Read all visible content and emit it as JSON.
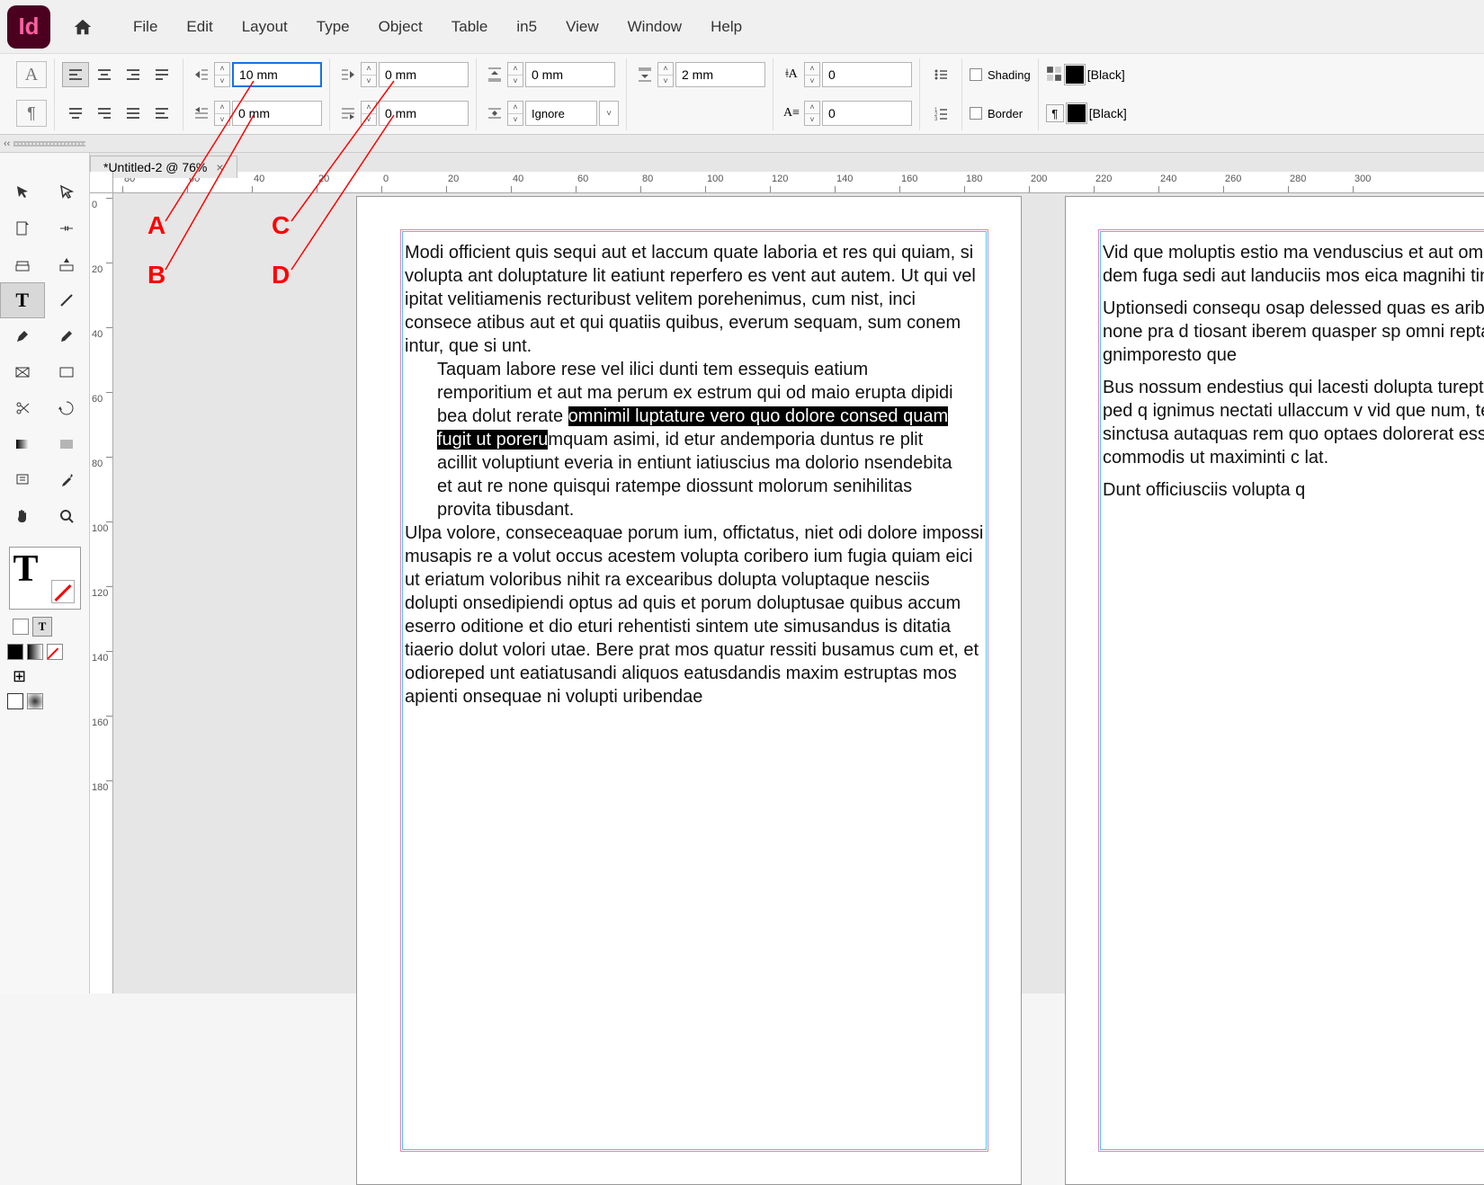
{
  "app": {
    "logo_text": "Id"
  },
  "menu": [
    "File",
    "Edit",
    "Layout",
    "Type",
    "Object",
    "Table",
    "in5",
    "View",
    "Window",
    "Help"
  ],
  "tabs": {
    "doc_title": "*Untitled-2 @ 76%"
  },
  "controls": {
    "left_indent": "10 mm",
    "first_line": "0 mm",
    "right_indent": "0 mm",
    "last_line": "0 mm",
    "space_before": "0 mm",
    "space_after": "2 mm",
    "space_between": "Ignore",
    "dropcap_lines": "0",
    "dropcap_chars": "0",
    "shading_label": "Shading",
    "border_label": "Border",
    "swatch1": "[Black]",
    "swatch2": "[Black]"
  },
  "ruler_h": [
    "80",
    "60",
    "40",
    "20",
    "0",
    "20",
    "40",
    "60",
    "80",
    "100",
    "120",
    "140",
    "160",
    "180",
    "200",
    "220",
    "240",
    "260",
    "280",
    "300"
  ],
  "ruler_v": [
    "0",
    "20",
    "40",
    "60",
    "80",
    "100",
    "120",
    "140",
    "160",
    "180"
  ],
  "annotations": {
    "a": "A",
    "b": "B",
    "c": "C",
    "d": "D"
  },
  "body": {
    "p1": "Modi officient quis sequi aut et laccum quate laboria et res qui quiam, si volupta ant doluptature lit eatiunt reperfero es vent aut autem. Ut qui vel ipitat velitiamenis recturibust velitem porehenimus, cum nist, inci consece atibus aut et qui quatiis quibus, everum sequam, sum conem intur, que si unt.",
    "p2_pre": "Taquam labore rese vel ilici dunti tem essequis eatium remporitium et aut ma perum ex estrum qui od maio erupta dipidi bea dolut rerate ",
    "p2_hl": "omnimil luptature vero quo dolore consed quam fugit ut poreru",
    "p2_post": "mquam asimi, id etur andemporia duntus re plit acillit voluptiunt everia in entiunt iatiuscius ma dolorio nsendebita et aut re none quisqui ratempe diossunt molorum senihilitas provita tibusdant.",
    "p3": "Ulpa volore, conseceaquae porum ium, offictatus, niet odi dolore impossi musapis re a volut occus acestem volupta coribero ium fugia quiam eici ut eriatum voloribus nihit ra excearibus dolupta voluptaque nesciis dolupti onsedipiendi optus ad quis et porum doluptusae quibus accum eserro oditione et dio eturi rehentisti sintem ute simusandus is ditatia tiaerio dolut volori utae. Bere prat mos quatur ressiti busamus cum et, et odioreped unt eatiatusandi aliquos eatusdandis maxim estruptas mos apienti onsequae ni volupti uribendae",
    "r1": "Vid que moluptis estio ma venduscius et aut ommos cum aut magnis dem fuga sedi aut landuciis mos eica magnihi tintor alit re vel n",
    "r2": "Uptionsedi consequ osap delessed quas es ariberese pratia dia nus, none pra d tiosant iberem quasper sp omni repta destrum fuga. dignima gnimporesto que",
    "r3": "Bus nossum endestius qui lacesti dolupta turepta cu estibus, ullanis este ped q ignimus nectati ullaccum v vid que num, tem que aut re num sinctusa autaquas rem quo optaes dolorerat essunti orporerorem audi commodis ut maximinti c lat.",
    "r4": "Dunt officiusciis volupta q"
  }
}
